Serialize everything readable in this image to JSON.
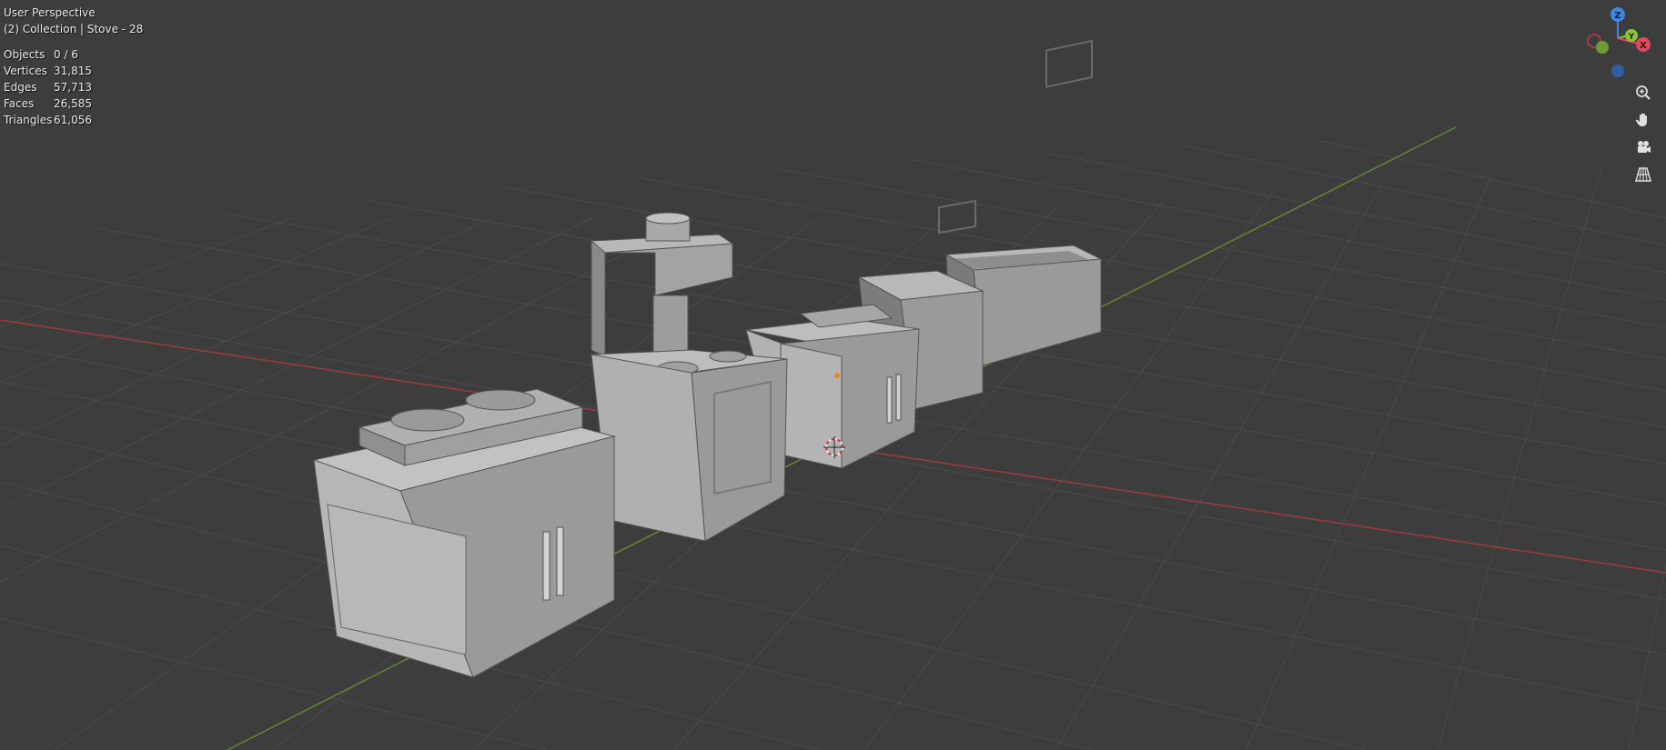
{
  "viewport": {
    "perspective_label": "User Perspective",
    "collection_label": "(2) Collection | Stove - 28"
  },
  "stats": [
    {
      "label": "Objects",
      "value": "0 / 6"
    },
    {
      "label": "Vertices",
      "value": "31,815"
    },
    {
      "label": "Edges",
      "value": "57,713"
    },
    {
      "label": "Faces",
      "value": "26,585"
    },
    {
      "label": "Triangles",
      "value": "61,056"
    }
  ],
  "gizmo": {
    "z_label": "Z",
    "y_label": "Y",
    "x_label": "X",
    "colors": {
      "x": "#e24a5b",
      "y": "#8ac43c",
      "z": "#3f86e0"
    }
  },
  "nav_buttons": [
    {
      "name": "zoom-icon"
    },
    {
      "name": "pan-hand-icon"
    },
    {
      "name": "camera-icon"
    },
    {
      "name": "perspective-grid-icon"
    }
  ],
  "colors": {
    "background": "#3d3d3d",
    "grid": "#4a4a4a",
    "x_axis": "#9b3b3b",
    "y_axis": "#5f8a2e"
  }
}
